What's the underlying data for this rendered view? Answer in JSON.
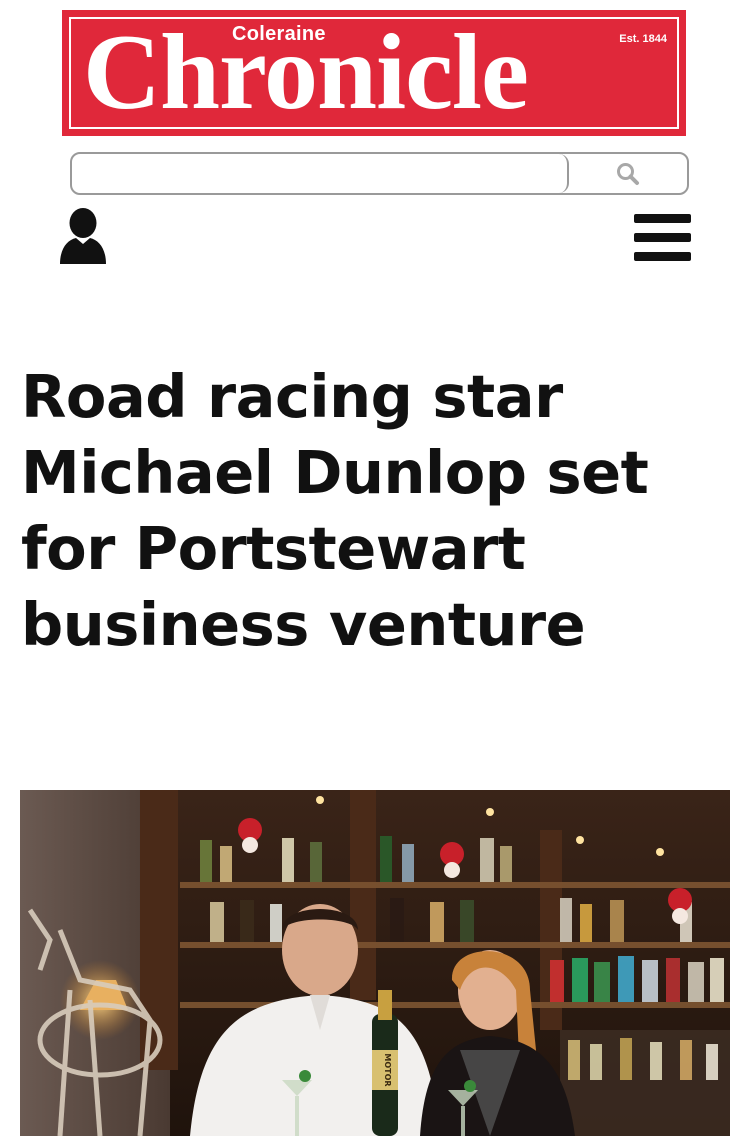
{
  "masthead": {
    "small_text": "Coleraine",
    "title": "Chronicle",
    "established": "Est. 1844"
  },
  "search": {
    "value": "",
    "placeholder": "",
    "icon": "search-icon"
  },
  "header_icons": {
    "account": "user-icon",
    "menu": "hamburger-menu-icon"
  },
  "article": {
    "headline": "Road racing star Michael Dunlop set for Portstewart business venture",
    "image_label": "MOTOR"
  },
  "colors": {
    "brand_red": "#e0283a",
    "headline": "#111111",
    "search_border": "#9a9a9a"
  }
}
